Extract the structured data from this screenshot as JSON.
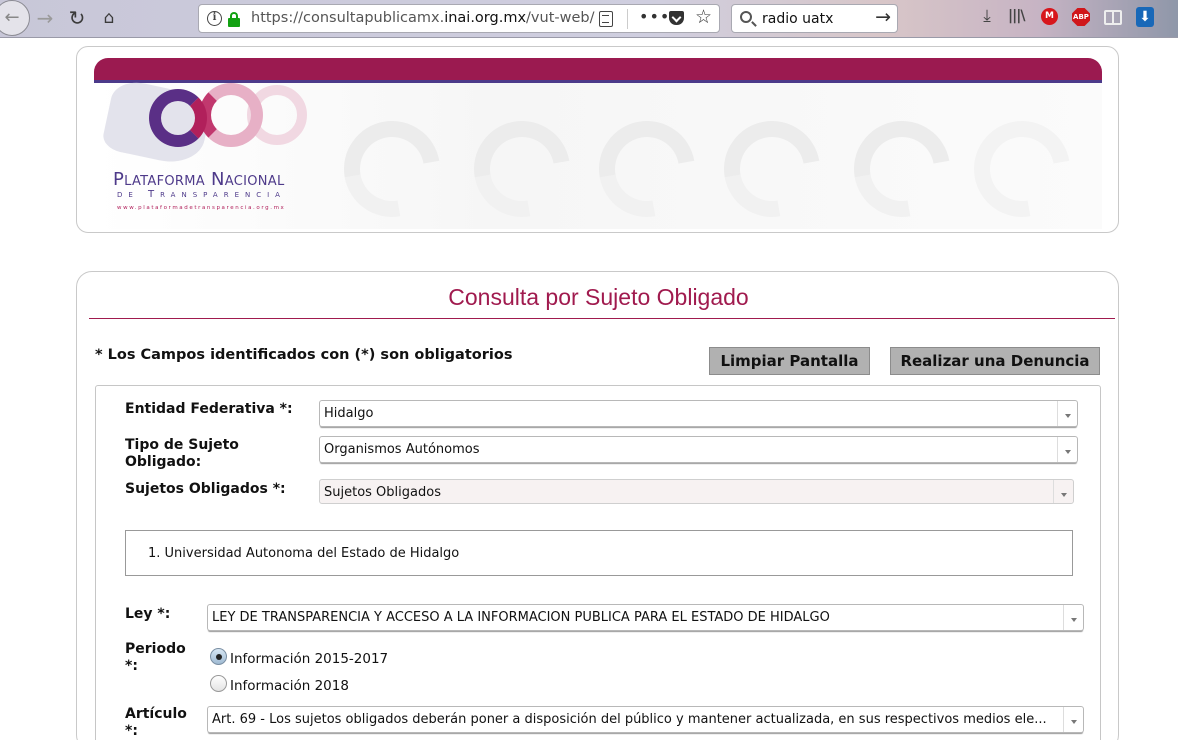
{
  "browser": {
    "url_prefix": "https://consultapublicamx.",
    "url_domain": "inai.org.mx",
    "url_path": "/vut-web/",
    "search_query": "radio uatx",
    "more_label": "•••",
    "mail_badge": "M",
    "abp_badge": "ABP"
  },
  "logo": {
    "line1": "Plataforma Nacional",
    "line2": "de Transparencia",
    "line3": "www.plataformadetransparencia.org.mx"
  },
  "form": {
    "title": "Consulta por Sujeto Obligado",
    "required_note": "* Los Campos identificados con (*) son obligatorios",
    "clear_button": "Limpiar Pantalla",
    "report_button": "Realizar una Denuncia",
    "entidad_label": "Entidad Federativa *:",
    "entidad_value": "Hidalgo",
    "tipo_label_1": "Tipo de Sujeto",
    "tipo_label_2": "Obligado:",
    "tipo_value": "Organismos Autónomos",
    "sujetos_label": "Sujetos Obligados *:",
    "sujetos_value": "Sujetos Obligados",
    "selected_subjects": [
      "1. Universidad Autonoma del Estado de Hidalgo"
    ],
    "ley_label": "Ley *:",
    "ley_value": "LEY DE TRANSPARENCIA Y ACCESO A LA INFORMACIÓN PÚBLICA PARA EL ESTADO DE HIDALGO",
    "periodo_label_1": "Periodo",
    "periodo_label_2": "*:",
    "periodo_options": [
      {
        "label": "Información 2015-2017",
        "checked": true
      },
      {
        "label": "Información 2018",
        "checked": false
      }
    ],
    "articulo_label_1": "Artículo",
    "articulo_label_2": "*:",
    "articulo_value": "Art. 69 - Los sujetos obligados deberán poner a disposición del público y mantener actualizada, en sus respectivos medios ele..."
  },
  "colors": {
    "brand": "#a01a4e",
    "brand_bar": "#9b1a50",
    "accent_purple": "#4c3a8a"
  }
}
